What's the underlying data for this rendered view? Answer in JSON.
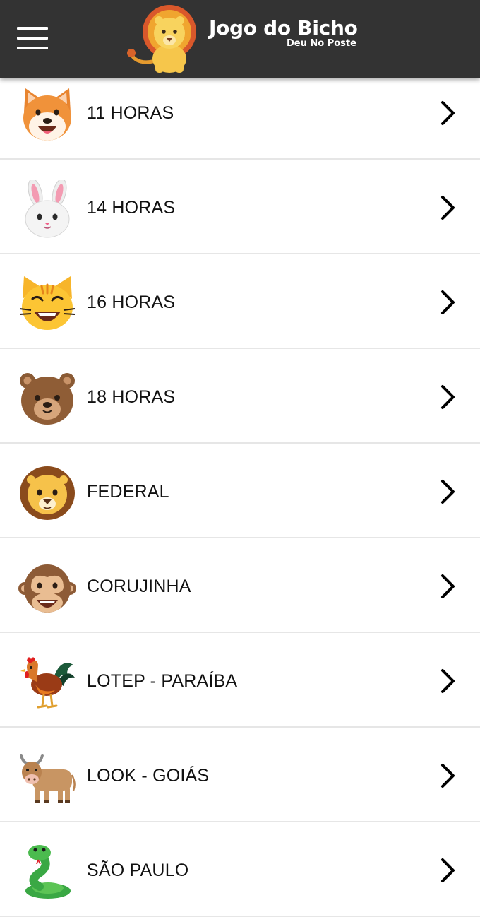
{
  "app": {
    "title": "Jogo do Bicho",
    "subtitle": "Deu No Poste",
    "header_color": "#333333",
    "menu_icon": "hamburger-menu-icon",
    "logo_icon": "lion-logo-icon"
  },
  "draws": [
    {
      "label": "11 HORAS",
      "icon": "dog-face-icon"
    },
    {
      "label": "14 HORAS",
      "icon": "rabbit-face-icon"
    },
    {
      "label": "16 HORAS",
      "icon": "cat-face-icon"
    },
    {
      "label": "18 HORAS",
      "icon": "bear-face-icon"
    },
    {
      "label": "FEDERAL",
      "icon": "lion-face-icon"
    },
    {
      "label": "CORUJINHA",
      "icon": "monkey-face-icon"
    },
    {
      "label": "LOTEP - PARAÍBA",
      "icon": "rooster-icon"
    },
    {
      "label": "LOOK - GOIÁS",
      "icon": "ox-icon"
    },
    {
      "label": "SÃO PAULO",
      "icon": "snake-icon"
    }
  ],
  "chevron_icon": "chevron-right-icon"
}
